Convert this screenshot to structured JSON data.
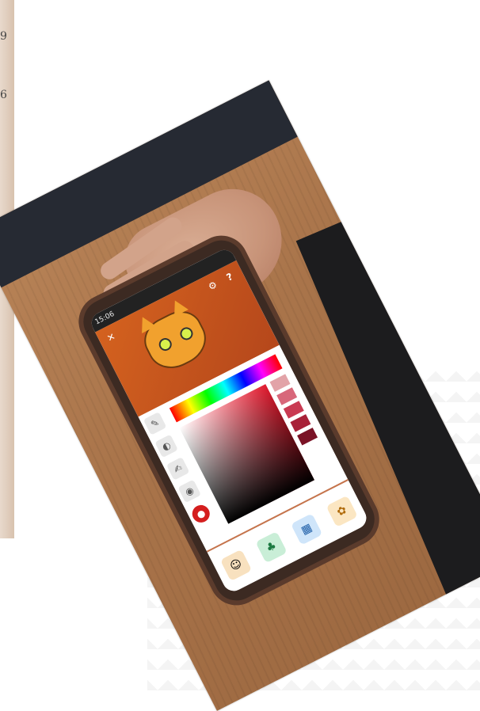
{
  "left_scrawl": [
    "9",
    "6"
  ],
  "phone": {
    "status_time": "15:06",
    "close_glyph": "✕",
    "settings_glyph": "⚙",
    "help_glyph": "?",
    "tools": [
      {
        "name": "stamp-tool",
        "glyph": "✎"
      },
      {
        "name": "fill-tool",
        "glyph": "◐"
      },
      {
        "name": "brush-tool",
        "glyph": "✍"
      },
      {
        "name": "eye-tool",
        "glyph": "◉"
      },
      {
        "name": "lips-tool",
        "glyph": "●"
      }
    ],
    "swatch_colors": [
      "#e2a3a8",
      "#d8677a",
      "#c93a52",
      "#a82138",
      "#7a1326"
    ],
    "bottom_nav": [
      {
        "name": "face-nav",
        "glyph": "☺",
        "color": "#f2c17d"
      },
      {
        "name": "clothes-nav",
        "glyph": "♣",
        "color": "#27a35a"
      },
      {
        "name": "background-nav",
        "glyph": "▦",
        "color": "#3d8fd9"
      },
      {
        "name": "paint-nav",
        "glyph": "✿",
        "color": "#e6a12c"
      }
    ]
  },
  "colors": {
    "cat_bg": "#c5541d",
    "accent": "#c5744c"
  }
}
